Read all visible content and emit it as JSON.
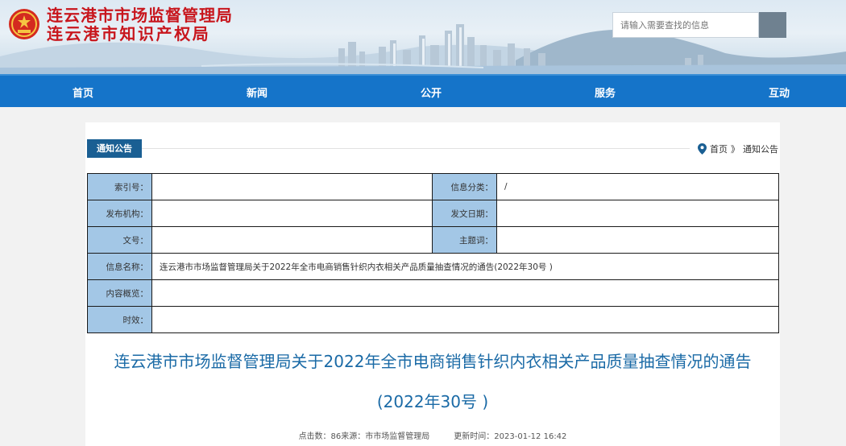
{
  "header": {
    "title_line1": "连云港市市场监督管理局",
    "title_line2": "连云港市知识产权局",
    "emblem_icon": "national-emblem-icon"
  },
  "search": {
    "placeholder": "请输入需要查找的信息"
  },
  "nav": {
    "items": [
      "首页",
      "新闻",
      "公开",
      "服务",
      "互动"
    ]
  },
  "section": {
    "tab_label": "通知公告",
    "breadcrumb": {
      "home": "首页",
      "separator": "》",
      "current": "通知公告"
    }
  },
  "info_table": {
    "index_label": "索引号：",
    "index_value": "",
    "category_label": "信息分类：",
    "category_value": "/",
    "publisher_label": "发布机构：",
    "publisher_value": "",
    "date_label": "发文日期：",
    "date_value": "",
    "doc_no_label": "文号：",
    "doc_no_value": "",
    "subject_label": "主题词：",
    "subject_value": "",
    "name_label": "信息名称：",
    "name_value": "连云港市市场监督管理局关于2022年全市电商销售针织内衣相关产品质量抽查情况的通告(2022年30号 )",
    "summary_label": "内容概览：",
    "summary_value": "",
    "validity_label": "时效：",
    "validity_value": ""
  },
  "article": {
    "title_line1": "连云港市市场监督管理局关于2022年全市电商销售针织内衣相关产品质量抽查情况的通告",
    "title_line2": "(2022年30号 )",
    "meta_clicks": "点击数：86",
    "meta_source": "来源：市市场监督管理局",
    "meta_updated": "更新时间：2023-01-12 16:42"
  },
  "colors": {
    "nav_bg": "#1574c9",
    "title_red": "#c8161d",
    "tab_bg": "#1a5f93",
    "label_bg": "#a3c7e6",
    "article_title": "#1a6aa6"
  }
}
